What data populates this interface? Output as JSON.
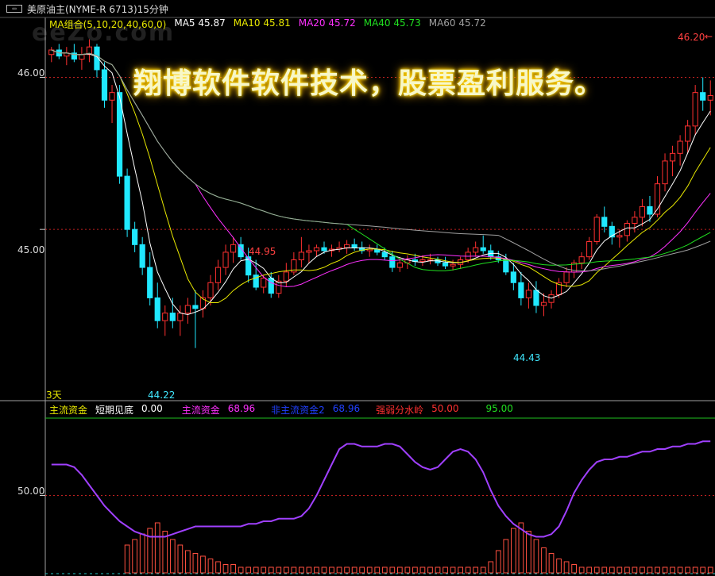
{
  "window": {
    "icon": "window-restore-icon",
    "title": "美原油主(NYME-R 6713)15分钟"
  },
  "logo_text": "eeZo.com",
  "watermark": "翔博软件软件技术，股票盈利服务。",
  "ma_legend": {
    "group": {
      "label": "MA组合(5,10,20,40,60,0)",
      "color": "#e8e800"
    },
    "ma5": {
      "label": "MA5 45.87",
      "color": "#ffffff"
    },
    "ma10": {
      "label": "MA10 45.81",
      "color": "#e8e800"
    },
    "ma20": {
      "label": "MA20 45.72",
      "color": "#ff30ff"
    },
    "ma40": {
      "label": "MA40 45.73",
      "color": "#20e020"
    },
    "ma60": {
      "label": "MA60 45.72",
      "color": "#a0a0a0"
    }
  },
  "price_axis": {
    "labels": [
      "46.00",
      "45.00"
    ]
  },
  "annotations": {
    "high_right": "46.20",
    "mid_high": "44.95",
    "low_left": "44.22",
    "low_right": "44.43",
    "period": "3天"
  },
  "indicator_legend": {
    "main_fund": {
      "label": "主流资金",
      "color": "#e8e800"
    },
    "short_bottom": {
      "label": "短期见底",
      "color": "#ffffff"
    },
    "short_bottom_val": {
      "label": "0.00",
      "color": "#ffffff"
    },
    "main_flow": {
      "label": "主流资金",
      "color": "#ff30ff"
    },
    "main_flow_val": {
      "label": "68.96",
      "color": "#ff30ff"
    },
    "non_main": {
      "label": "非主流资金2",
      "color": "#2040ff"
    },
    "non_main_val": {
      "label": "68.96",
      "color": "#2040ff"
    },
    "strength": {
      "label": "强弱分水岭",
      "color": "#ff3030"
    },
    "strength_val": {
      "label": "50.00",
      "color": "#ff3030"
    },
    "level": {
      "label": "95.00",
      "color": "#20e020"
    }
  },
  "indicator_axis": {
    "labels": [
      "50.00"
    ]
  },
  "chart_data": [
    {
      "type": "candlestick",
      "title": "美原油主(NYME-R 6713)15分钟",
      "ylim": [
        43.9,
        46.3
      ],
      "yticks": [
        45.0,
        46.0
      ],
      "candles": [
        [
          46.15,
          46.2,
          46.1,
          46.18
        ],
        [
          46.18,
          46.22,
          46.12,
          46.14
        ],
        [
          46.14,
          46.2,
          46.08,
          46.16
        ],
        [
          46.16,
          46.22,
          46.1,
          46.12
        ],
        [
          46.12,
          46.2,
          46.05,
          46.15
        ],
        [
          46.15,
          46.25,
          46.1,
          46.2
        ],
        [
          46.2,
          46.22,
          46.0,
          46.05
        ],
        [
          46.05,
          46.1,
          45.8,
          45.85
        ],
        [
          45.85,
          45.95,
          45.7,
          45.9
        ],
        [
          45.9,
          45.95,
          45.3,
          45.35
        ],
        [
          45.35,
          45.4,
          44.95,
          45.0
        ],
        [
          45.0,
          45.05,
          44.85,
          44.9
        ],
        [
          44.9,
          44.95,
          44.7,
          44.75
        ],
        [
          44.75,
          44.85,
          44.5,
          44.55
        ],
        [
          44.55,
          44.65,
          44.35,
          44.4
        ],
        [
          44.4,
          44.5,
          44.3,
          44.45
        ],
        [
          44.45,
          44.55,
          44.35,
          44.4
        ],
        [
          44.4,
          44.5,
          44.3,
          44.45
        ],
        [
          44.45,
          44.55,
          44.38,
          44.5
        ],
        [
          44.5,
          44.6,
          44.22,
          44.48
        ],
        [
          44.48,
          44.6,
          44.42,
          44.55
        ],
        [
          44.55,
          44.7,
          44.5,
          44.65
        ],
        [
          44.65,
          44.8,
          44.6,
          44.75
        ],
        [
          44.75,
          44.9,
          44.7,
          44.85
        ],
        [
          44.85,
          44.95,
          44.78,
          44.9
        ],
        [
          44.9,
          44.95,
          44.8,
          44.82
        ],
        [
          44.82,
          44.88,
          44.65,
          44.7
        ],
        [
          44.7,
          44.8,
          44.6,
          44.62
        ],
        [
          44.62,
          44.7,
          44.58,
          44.68
        ],
        [
          44.68,
          44.72,
          44.55,
          44.58
        ],
        [
          44.58,
          44.7,
          44.55,
          44.66
        ],
        [
          44.66,
          44.78,
          44.62,
          44.72
        ],
        [
          44.72,
          44.85,
          44.7,
          44.8
        ],
        [
          44.8,
          44.95,
          44.75,
          44.85
        ],
        [
          44.85,
          44.9,
          44.78,
          44.86
        ],
        [
          44.86,
          44.9,
          44.82,
          44.88
        ],
        [
          44.88,
          44.92,
          44.84,
          44.86
        ],
        [
          44.86,
          44.9,
          44.82,
          44.87
        ],
        [
          44.87,
          44.92,
          44.85,
          44.88
        ],
        [
          44.88,
          44.93,
          44.84,
          44.9
        ],
        [
          44.9,
          44.94,
          44.86,
          44.88
        ],
        [
          44.88,
          44.92,
          44.84,
          44.86
        ],
        [
          44.86,
          44.9,
          44.82,
          44.87
        ],
        [
          44.87,
          44.9,
          44.83,
          44.85
        ],
        [
          44.85,
          44.88,
          44.8,
          44.82
        ],
        [
          44.82,
          44.86,
          44.72,
          44.75
        ],
        [
          44.75,
          44.82,
          44.72,
          44.78
        ],
        [
          44.78,
          44.83,
          44.74,
          44.8
        ],
        [
          44.8,
          44.84,
          44.76,
          44.79
        ],
        [
          44.79,
          44.83,
          44.76,
          44.8
        ],
        [
          44.8,
          44.84,
          44.77,
          44.8
        ],
        [
          44.8,
          44.82,
          44.76,
          44.78
        ],
        [
          44.78,
          44.82,
          44.74,
          44.76
        ],
        [
          44.76,
          44.8,
          44.73,
          44.77
        ],
        [
          44.77,
          44.82,
          44.74,
          44.8
        ],
        [
          44.8,
          44.88,
          44.78,
          44.85
        ],
        [
          44.85,
          44.92,
          44.82,
          44.88
        ],
        [
          44.88,
          44.96,
          44.84,
          44.86
        ],
        [
          44.86,
          44.9,
          44.8,
          44.82
        ],
        [
          44.82,
          44.86,
          44.78,
          44.8
        ],
        [
          44.8,
          44.84,
          44.7,
          44.72
        ],
        [
          44.72,
          44.78,
          44.6,
          44.65
        ],
        [
          44.65,
          44.72,
          44.5,
          44.55
        ],
        [
          44.55,
          44.65,
          44.48,
          44.6
        ],
        [
          44.6,
          44.66,
          44.45,
          44.5
        ],
        [
          44.5,
          44.58,
          44.43,
          44.52
        ],
        [
          44.52,
          44.6,
          44.48,
          44.57
        ],
        [
          44.57,
          44.68,
          44.55,
          44.65
        ],
        [
          44.65,
          44.75,
          44.62,
          44.72
        ],
        [
          44.72,
          44.8,
          44.68,
          44.78
        ],
        [
          44.78,
          44.85,
          44.74,
          44.82
        ],
        [
          44.82,
          44.95,
          44.8,
          44.92
        ],
        [
          44.92,
          45.1,
          44.9,
          45.08
        ],
        [
          45.08,
          45.15,
          44.98,
          45.02
        ],
        [
          45.02,
          45.05,
          44.9,
          44.95
        ],
        [
          44.95,
          45.0,
          44.88,
          44.96
        ],
        [
          44.96,
          45.06,
          44.92,
          45.04
        ],
        [
          45.04,
          45.12,
          44.98,
          45.08
        ],
        [
          45.08,
          45.2,
          45.02,
          45.15
        ],
        [
          45.15,
          45.22,
          45.05,
          45.1
        ],
        [
          45.1,
          45.35,
          45.08,
          45.3
        ],
        [
          45.3,
          45.5,
          45.25,
          45.45
        ],
        [
          45.45,
          45.55,
          45.35,
          45.5
        ],
        [
          45.5,
          45.62,
          45.42,
          45.58
        ],
        [
          45.58,
          45.72,
          45.5,
          45.68
        ],
        [
          45.68,
          45.95,
          45.62,
          45.9
        ],
        [
          45.9,
          46.0,
          45.78,
          45.85
        ],
        [
          45.85,
          45.98,
          45.75,
          45.88
        ]
      ],
      "moving_averages": [
        "MA5",
        "MA10",
        "MA20",
        "MA40",
        "MA60"
      ],
      "annotations": [
        {
          "label": "46.20",
          "value": 46.2
        },
        {
          "label": "44.95",
          "value": 44.95
        },
        {
          "label": "44.22",
          "value": 44.22
        },
        {
          "label": "44.43",
          "value": 44.43
        }
      ]
    },
    {
      "type": "line",
      "title": "主流资金",
      "yticks": [
        50.0
      ],
      "reference_line": 50.0,
      "series": [
        {
          "name": "主流资金",
          "values": [
            62,
            62,
            62,
            61,
            58,
            54,
            50,
            46,
            43,
            40,
            38,
            36,
            35,
            34,
            34,
            34,
            35,
            36,
            37,
            38,
            38,
            38,
            38,
            38,
            38,
            38,
            39,
            39,
            40,
            40,
            41,
            41,
            41,
            42,
            45,
            50,
            56,
            62,
            68,
            70,
            70,
            69,
            69,
            69,
            70,
            70,
            69,
            66,
            63,
            61,
            60,
            61,
            64,
            67,
            68,
            67,
            64,
            59,
            52,
            46,
            42,
            39,
            37,
            35,
            34,
            34,
            35,
            38,
            44,
            51,
            56,
            60,
            63,
            64,
            64,
            65,
            65,
            66,
            67,
            67,
            68,
            68,
            69,
            69,
            70,
            70,
            71,
            71
          ]
        }
      ],
      "bars": [
        0,
        0,
        0,
        0,
        0,
        0,
        0,
        0,
        0,
        0,
        10,
        12,
        14,
        16,
        18,
        15,
        12,
        10,
        8,
        7,
        6,
        5,
        4,
        3,
        3,
        2,
        2,
        2,
        2,
        2,
        2,
        2,
        2,
        2,
        2,
        2,
        2,
        2,
        2,
        2,
        2,
        2,
        2,
        2,
        2,
        2,
        2,
        2,
        2,
        2,
        2,
        2,
        2,
        2,
        2,
        2,
        2,
        2,
        4,
        8,
        12,
        16,
        18,
        15,
        12,
        9,
        7,
        5,
        4,
        3,
        2,
        2,
        2,
        2,
        2,
        2,
        2,
        2,
        2,
        2,
        2,
        2,
        2,
        2,
        2,
        2,
        2,
        2
      ]
    }
  ]
}
